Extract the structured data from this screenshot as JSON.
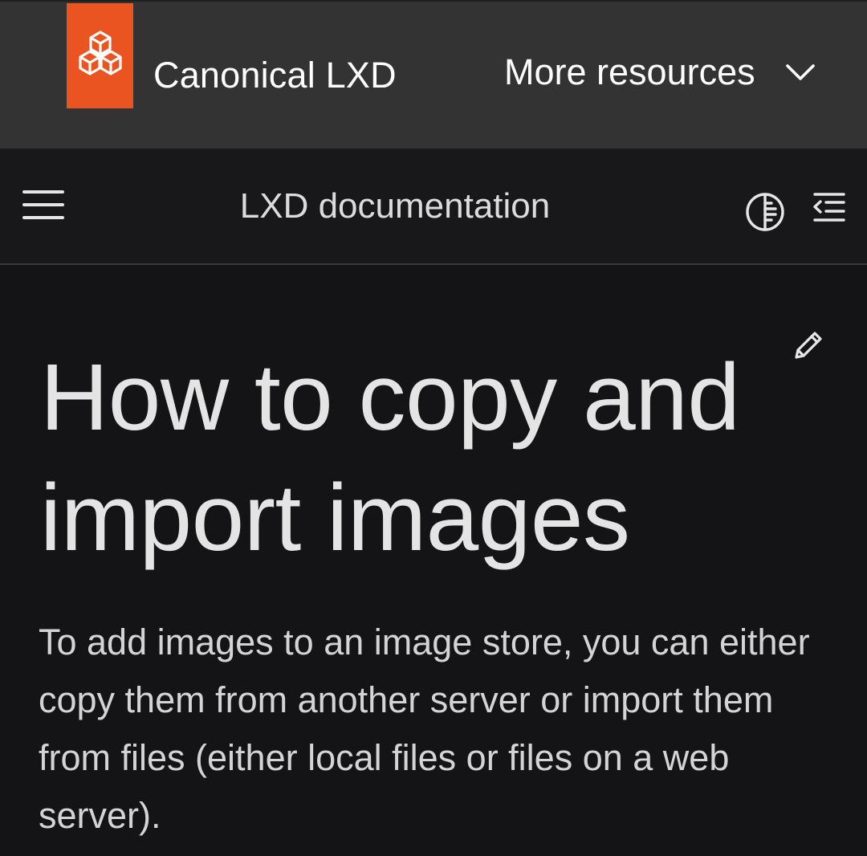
{
  "header": {
    "brand_name": "Canonical LXD",
    "brand_color": "#e95420",
    "logo_icon": "lxd-cubes-icon",
    "more_resources_label": "More resources",
    "dropdown_icon": "chevron-down-icon"
  },
  "docbar": {
    "title": "LXD documentation",
    "menu_icon": "hamburger-menu-icon",
    "theme_icon": "theme-toggle-icon",
    "toc_icon": "table-of-contents-icon"
  },
  "content": {
    "edit_icon": "pencil-edit-icon",
    "heading": "How to copy and import images",
    "intro": "To add images to an image store, you can either copy them from another server or import them from files (either local files or files on a web server)."
  },
  "colors": {
    "topbar_bg": "#333333",
    "page_bg": "#141416",
    "accent": "#e95420"
  }
}
